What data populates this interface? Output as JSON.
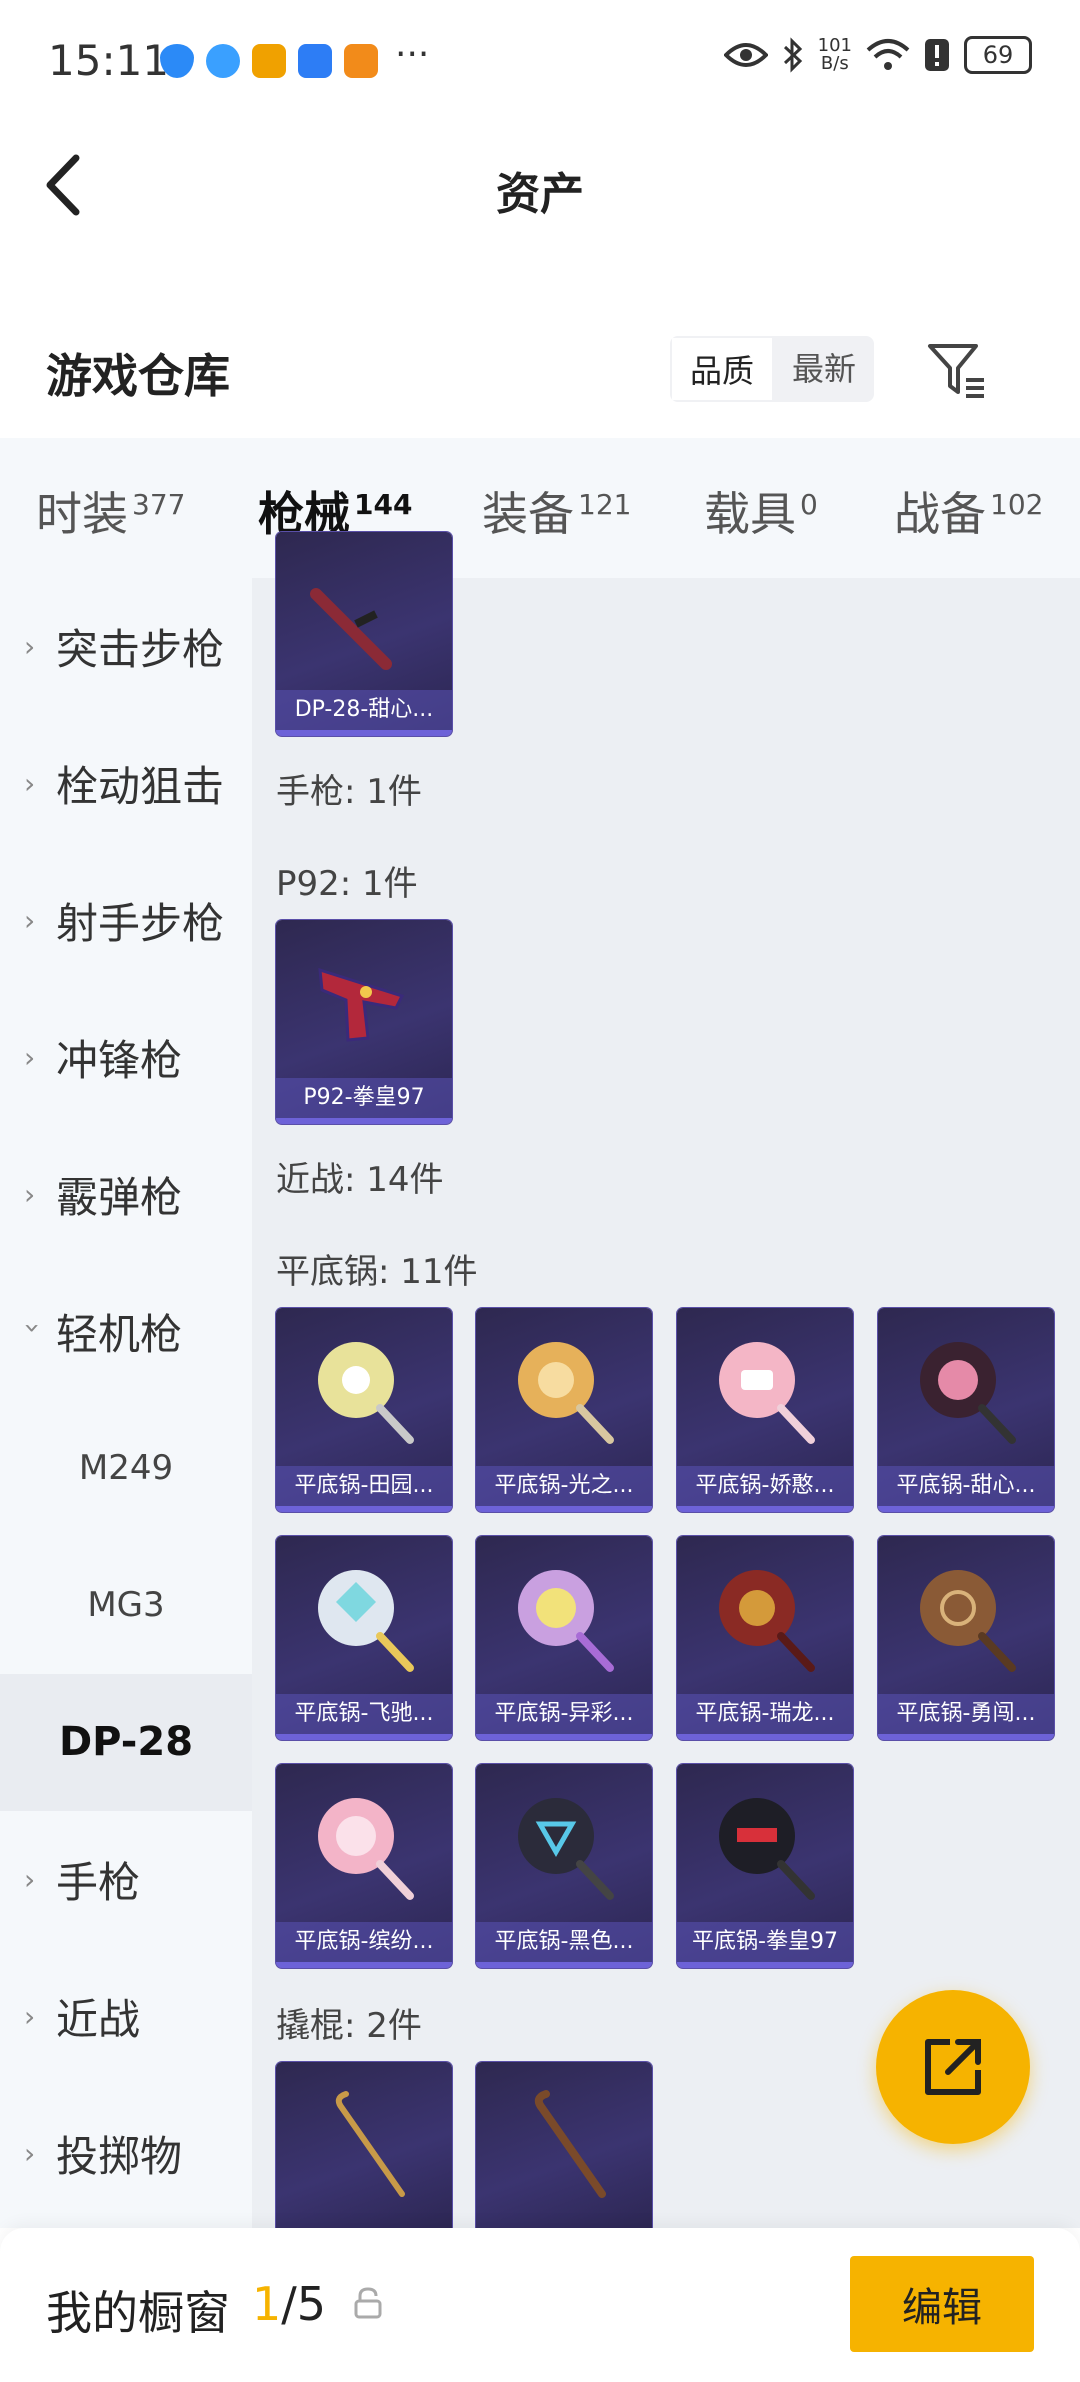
{
  "status_bar": {
    "time": "15:11",
    "net_speed_top": "101",
    "net_speed_bottom": "B/s",
    "battery": "69"
  },
  "header": {
    "title": "资产"
  },
  "warehouse": {
    "title": "游戏仓库",
    "sort_options": [
      {
        "label": "品质",
        "active": true
      },
      {
        "label": "最新",
        "active": false
      }
    ]
  },
  "tabs": [
    {
      "label": "时装",
      "count": "377"
    },
    {
      "label": "枪械",
      "count": "144",
      "active": true
    },
    {
      "label": "装备",
      "count": "121"
    },
    {
      "label": "载具",
      "count": "0"
    },
    {
      "label": "战备",
      "count": "102"
    }
  ],
  "sidebar": {
    "items": [
      {
        "label": "突击步枪"
      },
      {
        "label": "栓动狙击"
      },
      {
        "label": "射手步枪"
      },
      {
        "label": "冲锋枪"
      },
      {
        "label": "霰弹枪"
      },
      {
        "label": "轻机枪"
      },
      {
        "label": "手枪"
      },
      {
        "label": "近战"
      },
      {
        "label": "投掷物"
      }
    ],
    "subitems": [
      {
        "label": "M249"
      },
      {
        "label": "MG3"
      },
      {
        "label": "DP-28"
      }
    ]
  },
  "content": {
    "sections": {
      "handgun": "手枪: 1件",
      "p92": "P92: 1件",
      "melee": "近战: 14件",
      "pan": "平底锅: 11件",
      "crowbar": "撬棍: 2件"
    },
    "items": {
      "dp28": "DP-28-甜心...",
      "p92": "P92-拳皇97",
      "pans": [
        "平底锅-田园...",
        "平底锅-光之...",
        "平底锅-娇憨...",
        "平底锅-甜心...",
        "平底锅-飞驰...",
        "平底锅-异彩...",
        "平底锅-瑞龙...",
        "平底锅-勇闯...",
        "平底锅-缤纷...",
        "平底锅-黑色...",
        "平底锅-拳皇97"
      ]
    }
  },
  "showcase": {
    "title": "我的橱窗",
    "current": "1",
    "total": "/5",
    "edit_label": "编辑"
  },
  "colors": {
    "accent": "#f6b300",
    "card_bg": "#3b3470"
  }
}
